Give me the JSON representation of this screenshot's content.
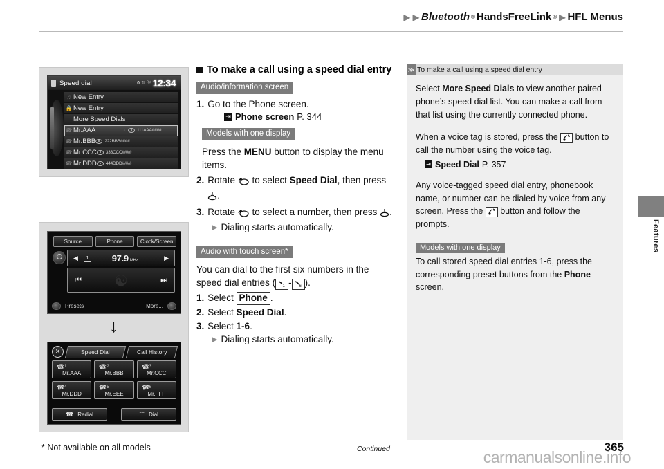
{
  "header": {
    "breadcrumb": [
      {
        "text": "Bluetooth",
        "italic": true,
        "sup": "®"
      },
      {
        "text": "HandsFreeLink",
        "italic": false,
        "sup": "®"
      },
      {
        "text": "HFL Menus",
        "italic": false,
        "sup": ""
      }
    ],
    "arrow_glyph": "▶"
  },
  "side_tab": {
    "label": "Features"
  },
  "figures": {
    "speed_dial_screen": {
      "title": "Speed dial",
      "status_battery": "0",
      "status_signal": "⇅",
      "status_roam": "ᴿᴹ",
      "clock": "12:34",
      "rows": [
        {
          "name": "New Entry",
          "number": "",
          "icon": "voice-tag-icon",
          "highlighted": false
        },
        {
          "name": "New Entry",
          "number": "",
          "icon": "lock-icon",
          "highlighted": false
        },
        {
          "name": "More Speed Dials",
          "number": "",
          "icon": "",
          "highlighted": false
        },
        {
          "name": "Mr.AAA",
          "number": "111AAA####",
          "icon": "handset-icon",
          "voicetag": "♪",
          "highlighted": true
        },
        {
          "name": "Mr.BBB",
          "number": "222BBB####",
          "icon": "handset-icon",
          "highlighted": false
        },
        {
          "name": "Mr.CCC",
          "number": "333CCC####",
          "icon": "handset-icon",
          "highlighted": false
        },
        {
          "name": "Mr.DDD",
          "number": "444DDD####",
          "icon": "handset-icon",
          "highlighted": false
        }
      ]
    },
    "radio_screen": {
      "buttons": [
        "Source",
        "Phone",
        "Clock/Screen"
      ],
      "preset": "1",
      "frequency": "97.9",
      "unit": "MHz",
      "left_arrow": "◀",
      "right_arrow": "▶",
      "seek_prev": "⏮",
      "seek_next": "⏭",
      "presets_label": "Presets",
      "more_label": "More..."
    },
    "arrow_between": "↓",
    "phone_touch_screen": {
      "close_glyph": "✕",
      "tabs": [
        {
          "label": "Speed Dial",
          "selected": true
        },
        {
          "label": "Call History",
          "selected": false
        }
      ],
      "presets": [
        {
          "index": "1",
          "label": "Mr.AAA"
        },
        {
          "index": "2",
          "label": "Mr.BBB"
        },
        {
          "index": "3",
          "label": "Mr.CCC"
        },
        {
          "index": "4",
          "label": "Mr.DDD"
        },
        {
          "index": "5",
          "label": "Mr.EEE"
        },
        {
          "index": "6",
          "label": "Mr.FFF"
        }
      ],
      "redial_label": "Redial",
      "redial_icon": "✆",
      "dial_label": "Dial",
      "dial_icon": "∷"
    }
  },
  "main": {
    "section_title": "To make a call using a speed dial entry",
    "badge_audio_info": "Audio/information screen",
    "badge_models_one_display": "Models with one display",
    "badge_audio_touch": "Audio with touch screen*",
    "step1_num": "1.",
    "step1_text": "Go to the Phone screen.",
    "ref1_bold": "Phone screen",
    "ref1_page": "P. 344",
    "menu_para_pre": "Press the ",
    "menu_para_bold": "MENU",
    "menu_para_post": " button to display the menu items.",
    "step2_num": "2.",
    "step2_pre": "Rotate ",
    "step2_mid": " to select ",
    "step2_bold": "Speed Dial",
    "step2_post": ", then press ",
    "step2_end": ".",
    "step3_num": "3.",
    "step3_pre": "Rotate ",
    "step3_mid": " to select a number, then press ",
    "step3_end": ".",
    "dialing_note": "Dialing starts automatically.",
    "touch_para_pre": "You can dial to the first six numbers in the speed dial entries (",
    "touch_para_dash": "-",
    "touch_para_post": ").",
    "t_step1_num": "1.",
    "t_step1_pre": "Select ",
    "t_step1_btn": "Phone",
    "t_step1_post": ".",
    "t_step2_num": "2.",
    "t_step2_pre": "Select ",
    "t_step2_bold": "Speed Dial",
    "t_step2_post": ".",
    "t_step3_num": "3.",
    "t_step3_pre": "Select ",
    "t_step3_bold": "1-6",
    "t_step3_post": ".",
    "t_dialing_note": "Dialing starts automatically."
  },
  "sidebar": {
    "head_title": "To make a call using a speed dial entry",
    "head_chevron": "≫",
    "p1_pre": "Select ",
    "p1_bold": "More Speed Dials",
    "p1_post": " to view another paired phone’s speed dial list. You can make a call from that list using the currently connected phone.",
    "p2_pre": "When a voice tag is stored, press the ",
    "p2_post": " button to call the number using the voice tag.",
    "ref_bold": "Speed Dial",
    "ref_page": "P. 357",
    "p3_pre": "Any voice-tagged speed dial entry, phonebook name, or number can be dialed by voice from any screen. Press the ",
    "p3_post": " button and follow the prompts.",
    "badge_models": "Models with one display",
    "p4_pre": "To call stored speed dial entries 1-6, press the corresponding preset buttons from the ",
    "p4_bold": "Phone",
    "p4_post": " screen."
  },
  "footer": {
    "footnote": "* Not available on all models",
    "continued": "Continued",
    "page_number": "365",
    "watermark": "carmanualsonline.info"
  }
}
